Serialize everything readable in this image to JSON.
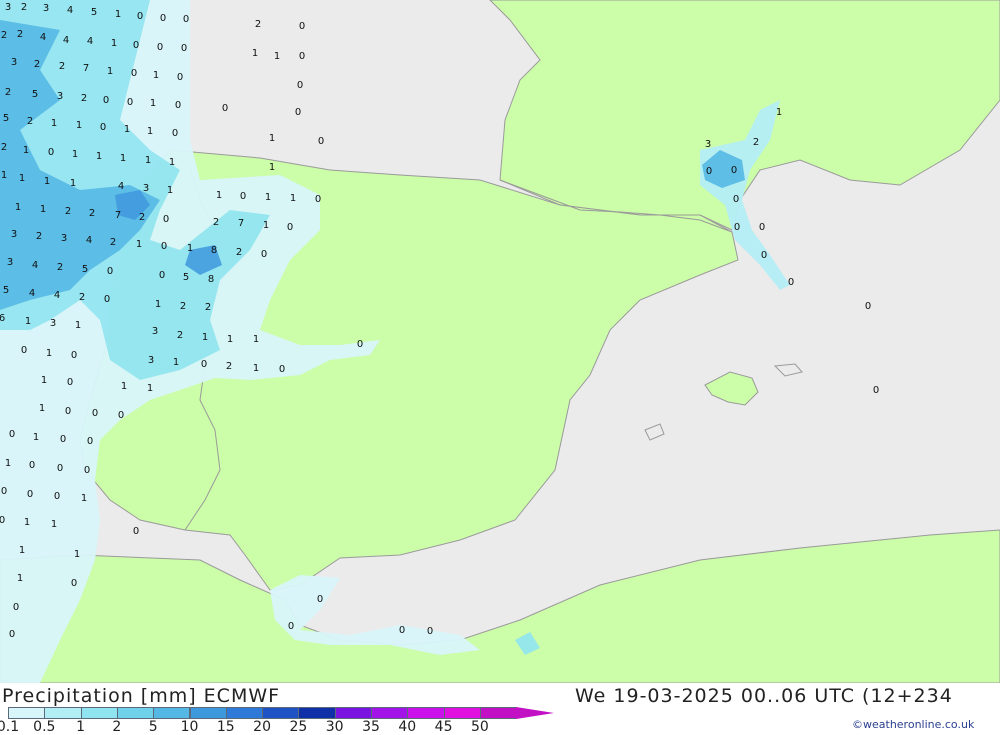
{
  "footer": {
    "title_left": "Precipitation [mm] ECMWF",
    "title_right": "We 19-03-2025 00..06 UTC (12+234",
    "credit": "©weatheronline.co.uk"
  },
  "legend": {
    "labels": [
      "0.1",
      "0.5",
      "1",
      "2",
      "5",
      "10",
      "15",
      "20",
      "25",
      "30",
      "35",
      "40",
      "45",
      "50"
    ],
    "colors": [
      "#d8f6fa",
      "#b4eef5",
      "#8fe4ef",
      "#6fd2ea",
      "#55b8e4",
      "#3e98dc",
      "#2f7ad8",
      "#1f52c4",
      "#1030a8",
      "#7a14e0",
      "#a214e8",
      "#cc10ec",
      "#e010e0",
      "#c210c4"
    ]
  },
  "colors": {
    "land": "#ccfda8",
    "sea": "#ebebeb",
    "border": "#9a9a9a"
  },
  "values": [
    "3",
    "2",
    "3",
    "4",
    "5",
    "1",
    "0",
    "0",
    "0",
    "2",
    "0",
    "2",
    "2",
    "4",
    "4",
    "4",
    "1",
    "0",
    "0",
    "0",
    "1",
    "0",
    "3",
    "2",
    "2",
    "7",
    "1",
    "0",
    "1",
    "0",
    "1",
    "0",
    "2",
    "5",
    "3",
    "2",
    "0",
    "0",
    "1",
    "0",
    "0",
    "0",
    "5",
    "2",
    "1",
    "1",
    "0",
    "1",
    "1",
    "0",
    "1",
    "0",
    "2",
    "1",
    "0",
    "1",
    "1",
    "1",
    "1",
    "1",
    "1",
    "1",
    "1",
    "1",
    "1",
    "4",
    "3",
    "1",
    "1",
    "1",
    "2",
    "2",
    "7",
    "2",
    "0",
    "1",
    "0",
    "1",
    "1",
    "0",
    "3",
    "2",
    "3",
    "4",
    "2",
    "1",
    "0",
    "1",
    "8",
    "2",
    "0",
    "2",
    "7",
    "1",
    "0",
    "3",
    "4",
    "2",
    "5",
    "0",
    "0",
    "5",
    "8",
    "5",
    "4",
    "4",
    "2",
    "0",
    "1",
    "2",
    "2",
    "6",
    "1",
    "3",
    "1",
    "3",
    "2",
    "1",
    "1",
    "1",
    "0",
    "1",
    "0",
    "3",
    "1",
    "0",
    "2",
    "1",
    "0",
    "0",
    "1",
    "0",
    "1",
    "1",
    "1",
    "0",
    "0",
    "0",
    "0",
    "1",
    "0",
    "0",
    "1",
    "0",
    "0",
    "0",
    "0",
    "0",
    "0",
    "1",
    "0",
    "1",
    "1",
    "0",
    "1",
    "1",
    "1",
    "0",
    "0",
    "0",
    "0",
    "0",
    "0",
    "0",
    "3",
    "2",
    "1",
    "0",
    "0",
    "0",
    "0",
    "0",
    "0",
    "0",
    "0",
    "0"
  ]
}
